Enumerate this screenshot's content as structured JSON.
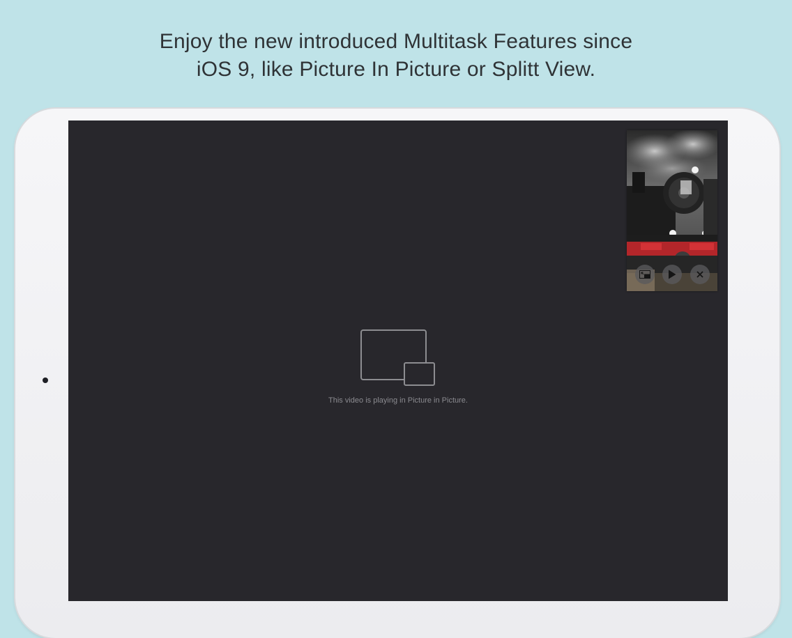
{
  "headline": {
    "line1": "Enjoy the new introduced Multitask Features since",
    "line2": "iOS 9, like Picture In Picture or Splitt View."
  },
  "device": {
    "name": "iPad",
    "bezel_color": "#f3f3f5",
    "screen_color": "#28272c"
  },
  "player": {
    "placeholder_icon": "picture-in-picture-icon",
    "caption": "This video is playing in Picture in Picture."
  },
  "pip_window": {
    "content": "steam locomotive video",
    "controls": [
      {
        "name": "restore-pip-button",
        "icon": "pip-restore-icon"
      },
      {
        "name": "play-button",
        "icon": "play-icon"
      },
      {
        "name": "close-pip-button",
        "icon": "close-icon"
      }
    ]
  },
  "colors": {
    "background": "#bfe3e8",
    "headline_text": "#2f3336",
    "caption_text": "#8b8b90"
  }
}
